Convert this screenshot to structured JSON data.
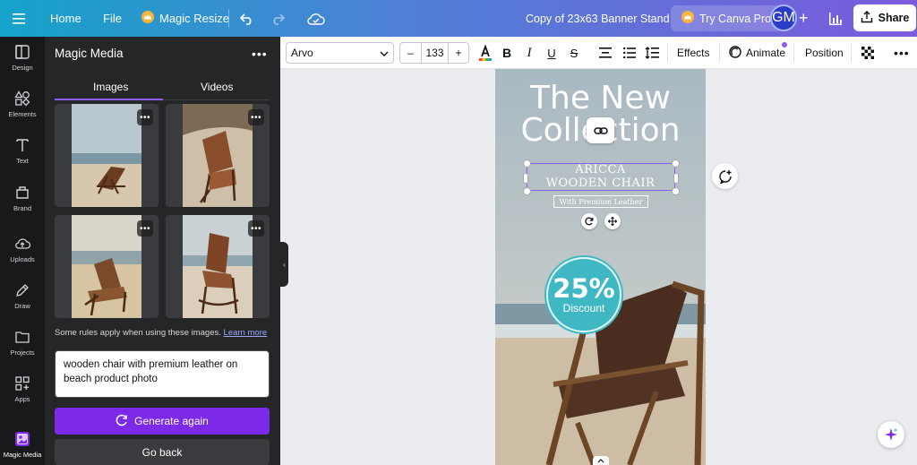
{
  "topbar": {
    "home": "Home",
    "file": "File",
    "magic_resize": "Magic Resize",
    "doc_title": "Copy of 23x63  Banner Stand",
    "try_pro": "Try Canva Pro",
    "avatar_initials": "GM",
    "share": "Share",
    "accent": "#7d2ae8"
  },
  "rail": {
    "items": [
      {
        "label": "Design",
        "icon": "design-icon"
      },
      {
        "label": "Elements",
        "icon": "elements-icon"
      },
      {
        "label": "Text",
        "icon": "text-icon"
      },
      {
        "label": "Brand",
        "icon": "brand-icon"
      },
      {
        "label": "Uploads",
        "icon": "upload-icon"
      },
      {
        "label": "Draw",
        "icon": "draw-icon"
      },
      {
        "label": "Projects",
        "icon": "folder-icon"
      },
      {
        "label": "Apps",
        "icon": "apps-icon"
      },
      {
        "label": "Magic Media",
        "icon": "magic-media-icon"
      }
    ]
  },
  "panel": {
    "title": "Magic Media",
    "tabs": [
      "Images",
      "Videos"
    ],
    "active_tab": "Images",
    "rules_text": "Some rules apply when using these images.",
    "learn_more": "Learn more",
    "prompt": "wooden chair with premium leather on beach product photo",
    "generate_again": "Generate again",
    "go_back": "Go back"
  },
  "toolbar": {
    "font": "Arvo",
    "size_minus": "–",
    "font_size": "133",
    "size_plus": "+",
    "effects": "Effects",
    "animate": "Animate",
    "position": "Position"
  },
  "design": {
    "headline_line1": "The New",
    "headline_line2": "Collection",
    "subhead_line1": "ARICCA",
    "subhead_line2": "WOODEN CHAIR",
    "tagline": "With Premium Leather",
    "discount_pct": "25%",
    "discount_word": "Discount",
    "discount_color": "#3fb8c4"
  }
}
